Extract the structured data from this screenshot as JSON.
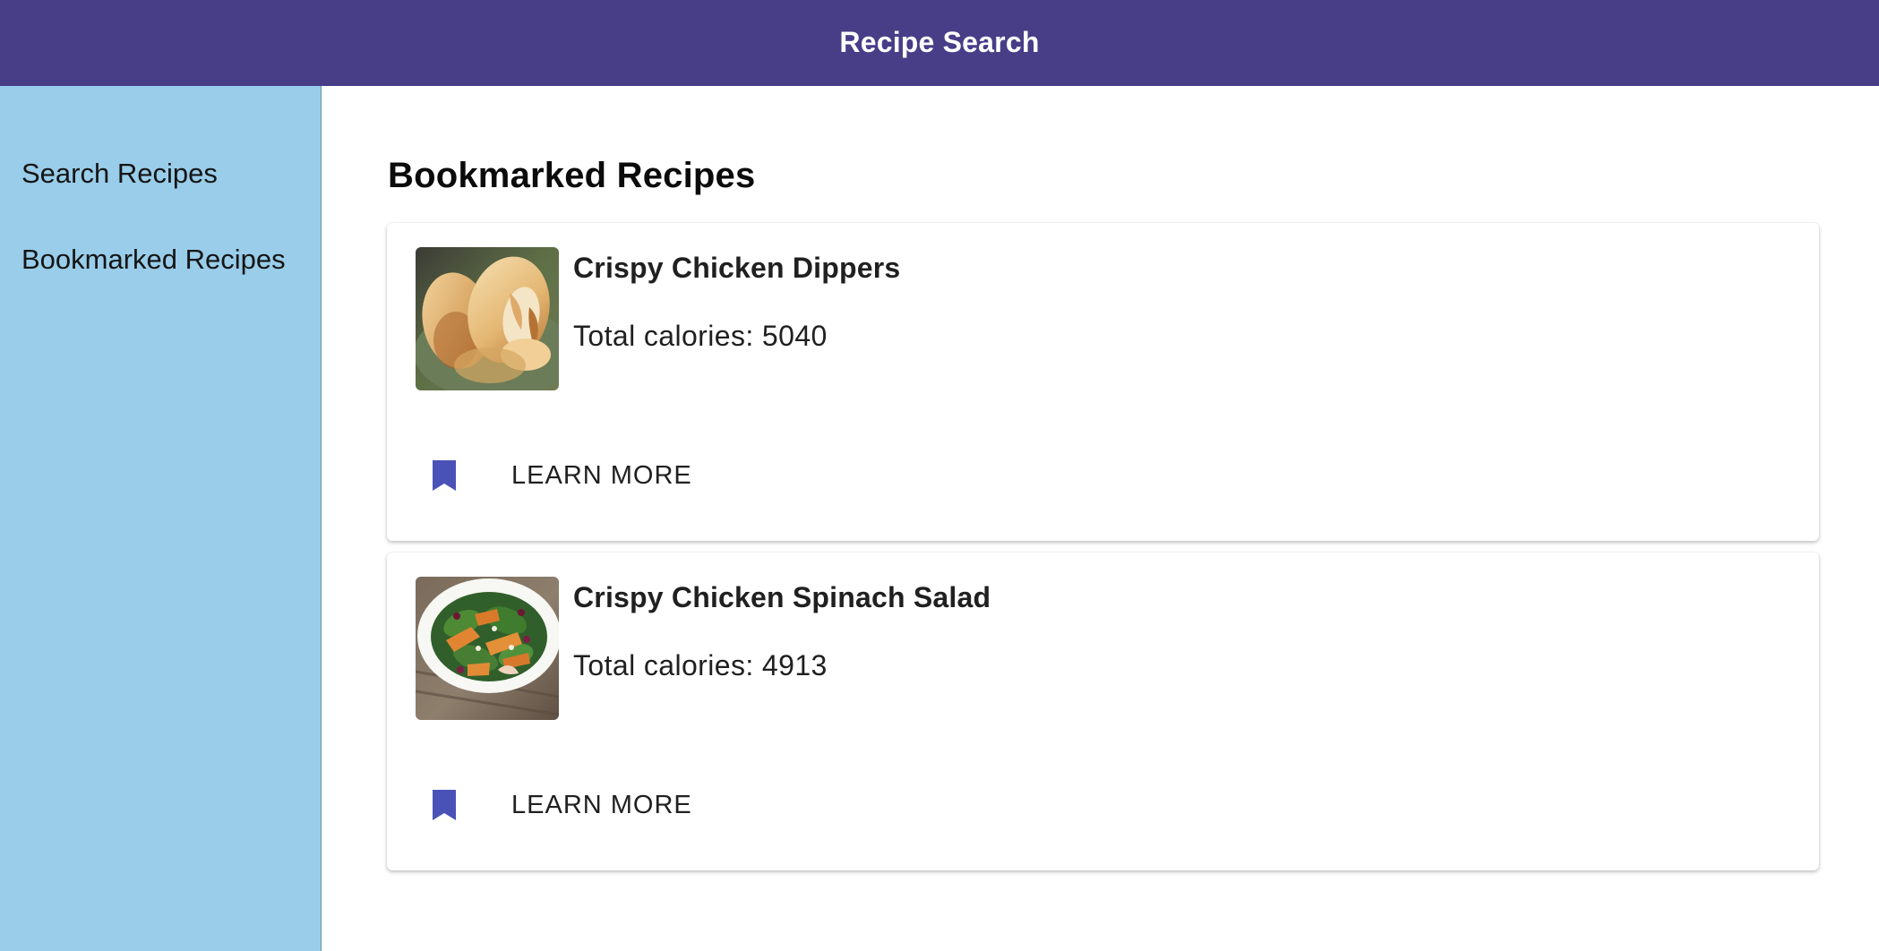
{
  "header": {
    "title": "Recipe Search",
    "bg_color": "#483d87"
  },
  "sidebar": {
    "bg_color": "#99cdea",
    "items": [
      {
        "label": "Search Recipes"
      },
      {
        "label": "Bookmarked Recipes"
      }
    ]
  },
  "main": {
    "title": "Bookmarked Recipes",
    "recipes": [
      {
        "name": "Crispy Chicken Dippers",
        "calories": "Total calories: 5040",
        "image_icon": "chicken-dippers-photo",
        "bookmark_icon": "bookmark-icon",
        "action_label": "LEARN MORE"
      },
      {
        "name": "Crispy Chicken Spinach Salad",
        "calories": "Total calories: 4913",
        "image_icon": "chicken-spinach-salad-photo",
        "bookmark_icon": "bookmark-icon",
        "action_label": "LEARN MORE"
      }
    ]
  },
  "colors": {
    "bookmark": "#4a52b7",
    "text": "#202020",
    "card_bg": "#ffffff"
  }
}
